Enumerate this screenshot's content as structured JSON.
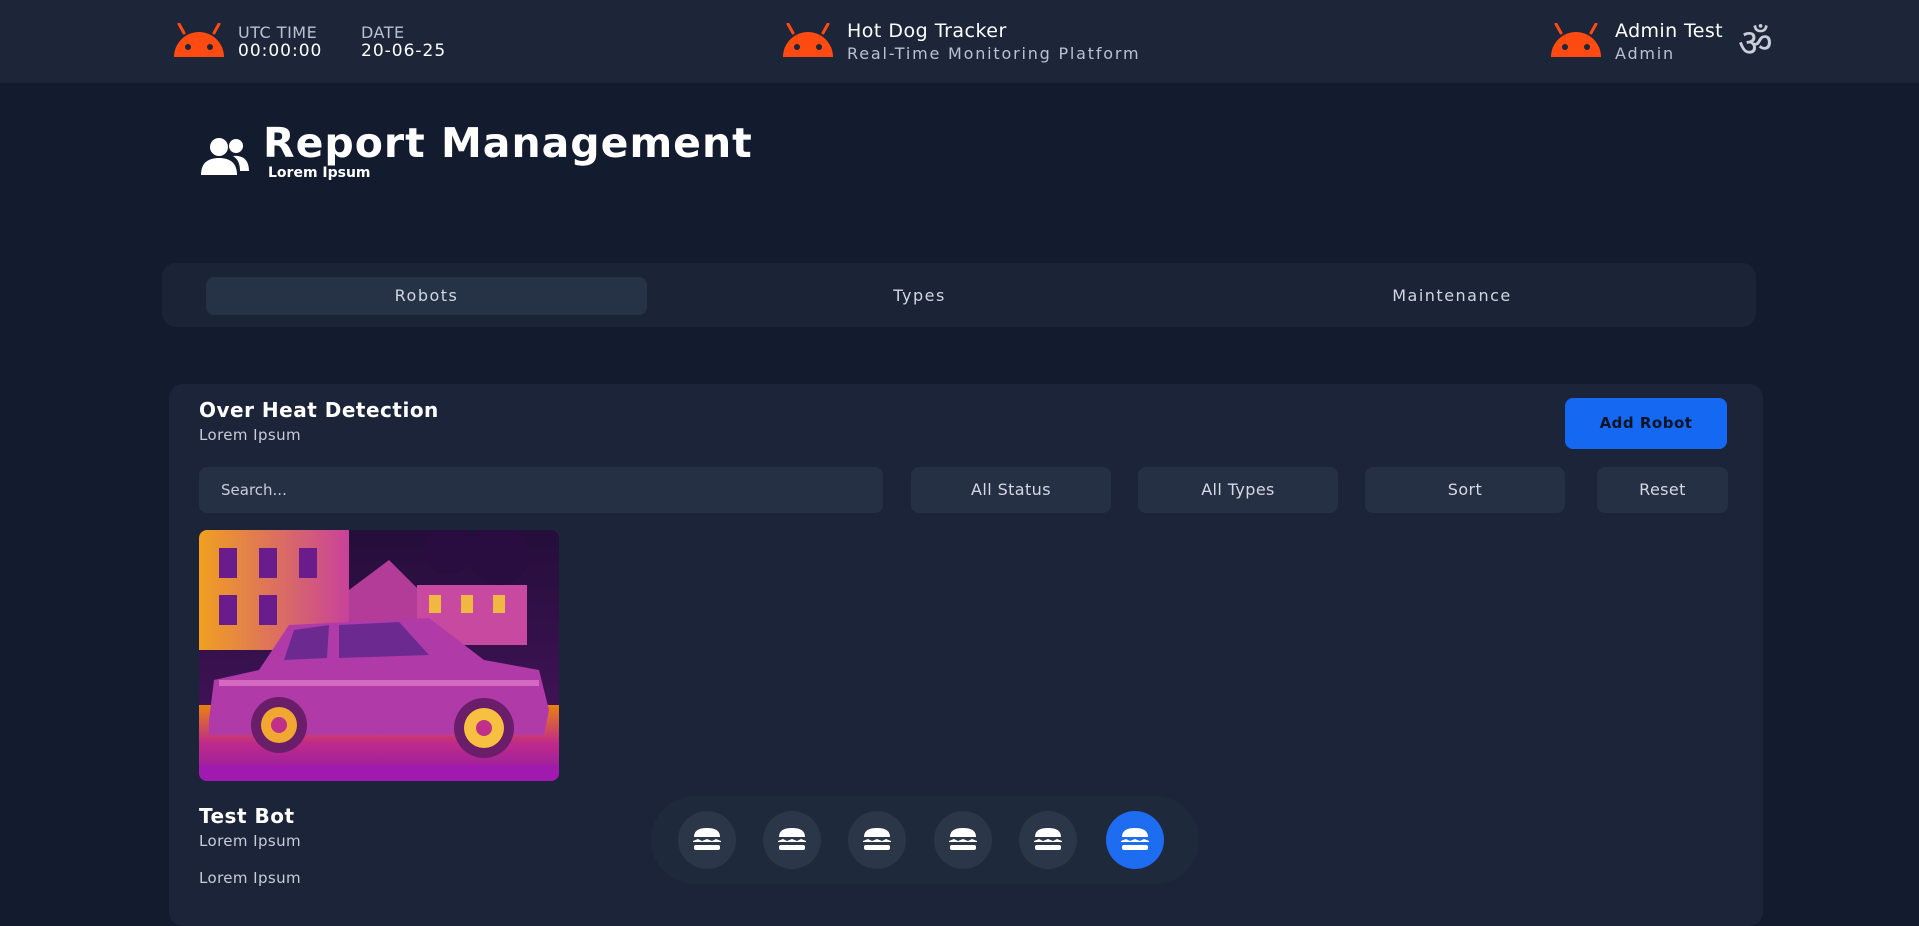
{
  "header": {
    "utc_label": "UTC TIME",
    "utc_value": "00:00:00",
    "date_label": "DATE",
    "date_value": "20-06-25",
    "app_title": "Hot Dog Tracker",
    "app_subtitle": "Real-Time Monitoring Platform",
    "user_name": "Admin Test",
    "user_role": "Admin",
    "menu_glyph": "ॐ",
    "icon": "android-icon",
    "accent": "#ff4a12"
  },
  "page": {
    "title": "Report Management",
    "subtitle": "Lorem Ipsum",
    "icon": "users-icon"
  },
  "tabs": [
    {
      "label": "Robots",
      "active": true
    },
    {
      "label": "Types",
      "active": false
    },
    {
      "label": "Maintenance",
      "active": false
    }
  ],
  "section": {
    "title": "Over Heat Detection",
    "subtitle": "Lorem Ipsum",
    "add_button": "Add Robot",
    "search_placeholder": "Search...",
    "filters": [
      "All Status",
      "All Types",
      "Sort",
      "Reset"
    ]
  },
  "card": {
    "title": "Test Bot",
    "line1": "Lorem Ipsum",
    "line2": "Lorem Ipsum",
    "image": "thermal-car-image"
  },
  "pager": {
    "icon": "burger-icon",
    "count": 6,
    "active_index": 5,
    "active_color": "#1e6cf0"
  }
}
